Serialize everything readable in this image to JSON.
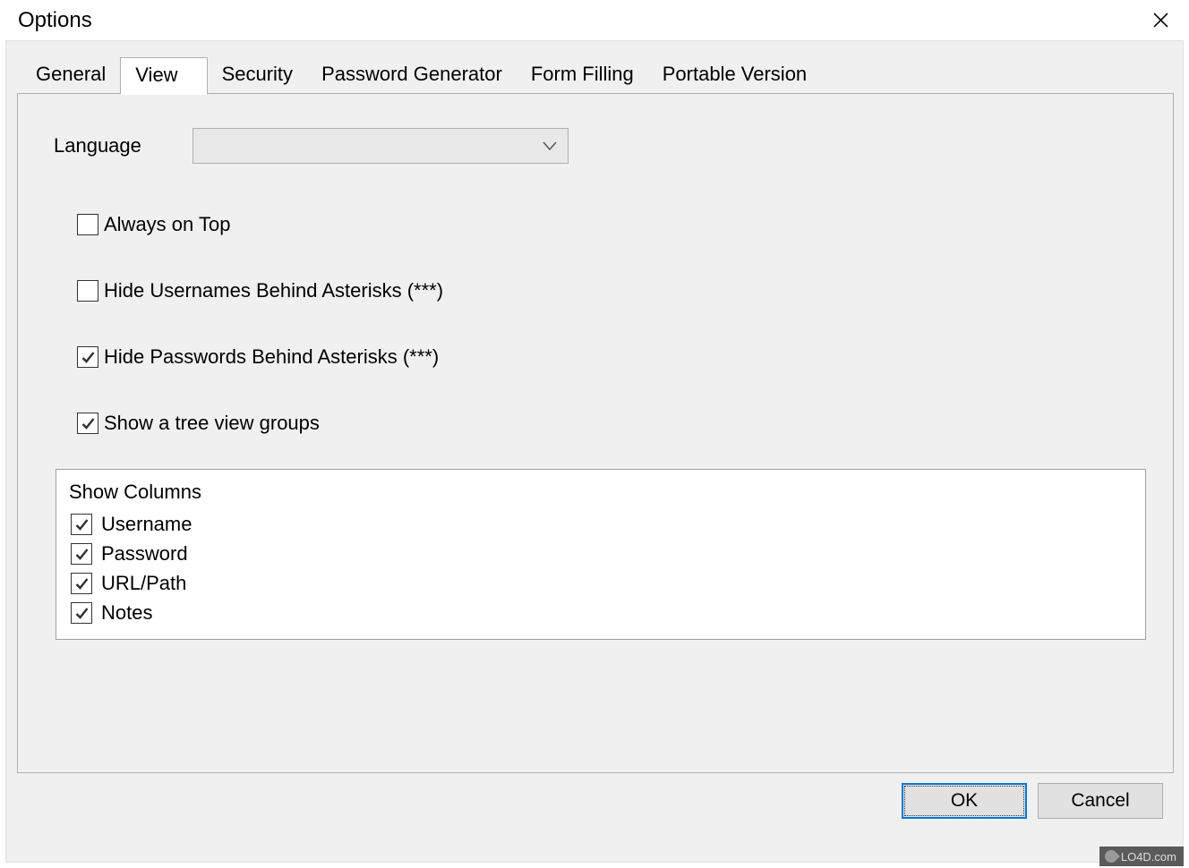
{
  "title": "Options",
  "tabs": [
    {
      "label": "General",
      "active": false
    },
    {
      "label": "View",
      "active": true
    },
    {
      "label": "Security",
      "active": false
    },
    {
      "label": "Password Generator",
      "active": false
    },
    {
      "label": "Form Filling",
      "active": false
    },
    {
      "label": "Portable Version",
      "active": false
    }
  ],
  "view": {
    "language_label": "Language",
    "language_value": "",
    "options": [
      {
        "label": "Always on Top",
        "checked": false
      },
      {
        "label": "Hide Usernames Behind Asterisks (***)",
        "checked": false
      },
      {
        "label": "Hide Passwords Behind Asterisks (***)",
        "checked": true
      },
      {
        "label": "Show a tree view groups",
        "checked": true
      }
    ],
    "columns_label": "Show Columns",
    "columns": [
      {
        "label": "Username",
        "checked": true
      },
      {
        "label": "Password",
        "checked": true
      },
      {
        "label": "URL/Path",
        "checked": true
      },
      {
        "label": "Notes",
        "checked": true
      }
    ]
  },
  "buttons": {
    "ok": "OK",
    "cancel": "Cancel"
  },
  "watermark": "LO4D.com"
}
